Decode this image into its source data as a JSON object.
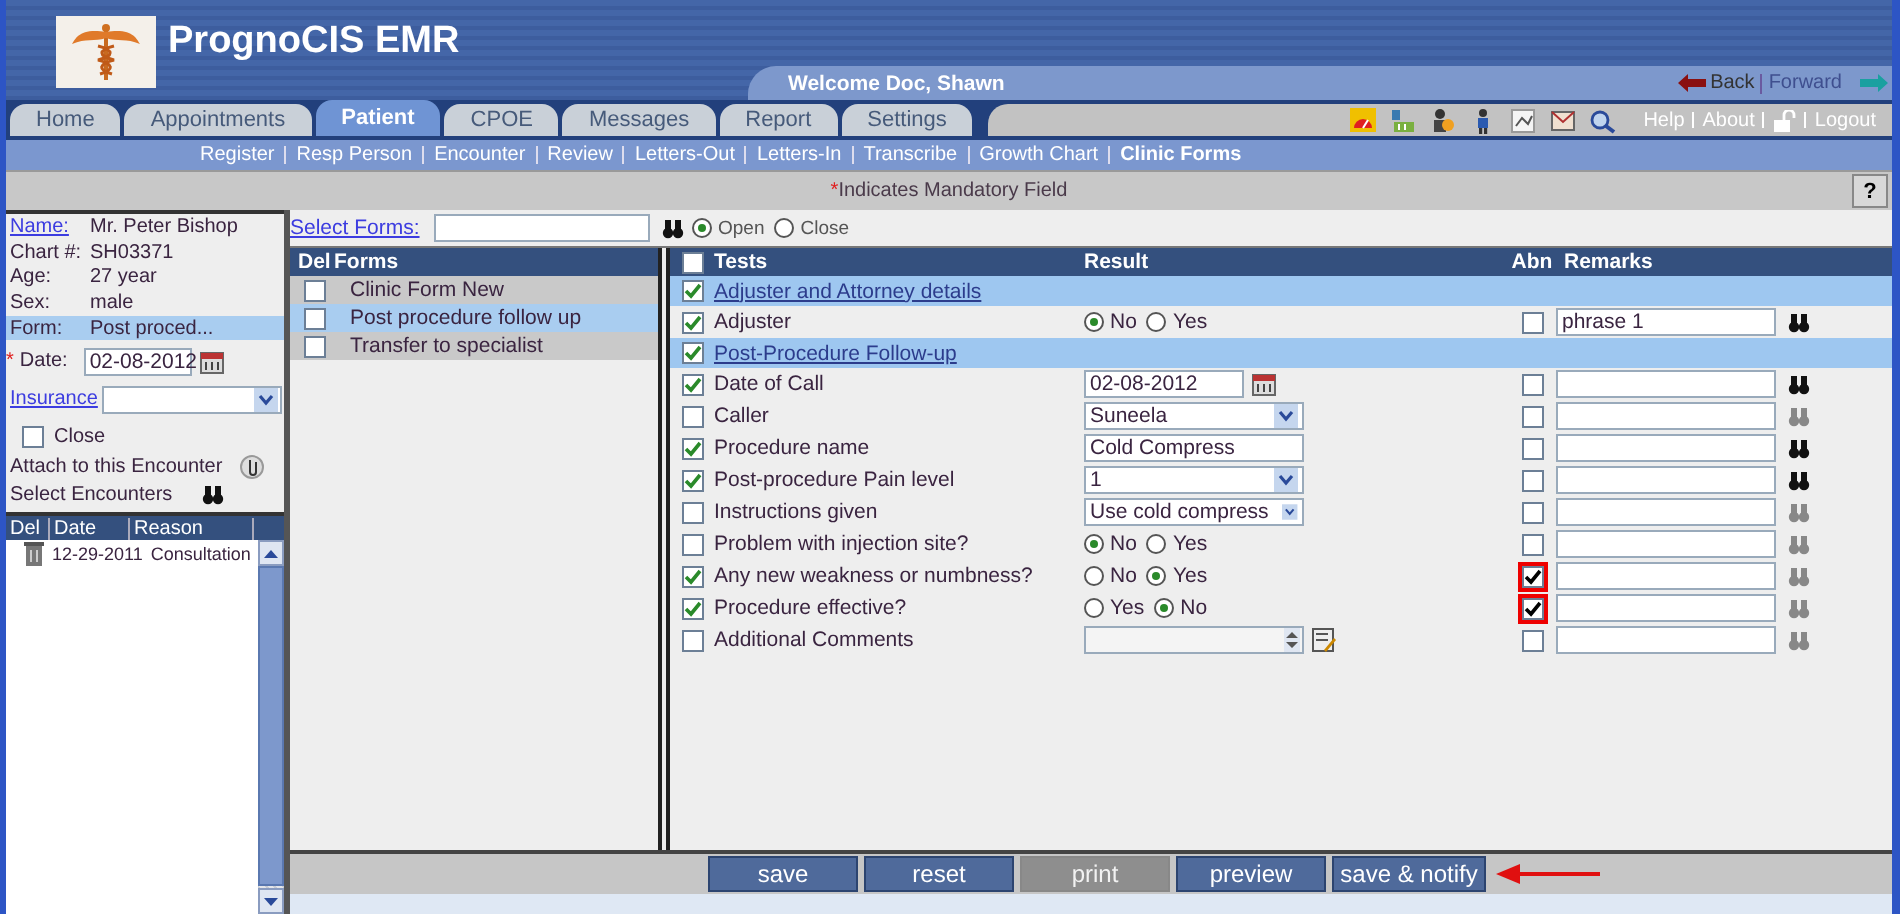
{
  "app": {
    "title": "PrognoCIS EMR",
    "welcome": "Welcome Doc, Shawn",
    "back": "Back",
    "forward": "Forward"
  },
  "tabs": [
    {
      "label": "Home",
      "selected": false
    },
    {
      "label": "Appointments",
      "selected": false
    },
    {
      "label": "Patient",
      "selected": true
    },
    {
      "label": "CPOE",
      "selected": false
    },
    {
      "label": "Messages",
      "selected": false
    },
    {
      "label": "Report",
      "selected": false
    },
    {
      "label": "Settings",
      "selected": false
    }
  ],
  "toolbar_links": [
    "Help",
    "About",
    "Logout"
  ],
  "subnav": [
    {
      "label": "Register",
      "selected": false
    },
    {
      "label": "Resp Person",
      "selected": false
    },
    {
      "label": "Encounter",
      "selected": false
    },
    {
      "label": "Review",
      "selected": false
    },
    {
      "label": "Letters-Out",
      "selected": false
    },
    {
      "label": "Letters-In",
      "selected": false
    },
    {
      "label": "Transcribe",
      "selected": false
    },
    {
      "label": "Growth Chart",
      "selected": false
    },
    {
      "label": "Clinic Forms",
      "selected": true
    }
  ],
  "mandatory_note": {
    "mark": "*",
    "text": "Indicates Mandatory Field"
  },
  "help_button": "?",
  "patient": {
    "fields": [
      {
        "label": "Name:",
        "value": "Mr. Peter Bishop",
        "link": true,
        "highlighted": false
      },
      {
        "label": "Chart #:",
        "value": "SH03371",
        "link": false,
        "highlighted": false
      },
      {
        "label": "Age:",
        "value": "27 year",
        "link": false,
        "highlighted": false
      },
      {
        "label": "Sex:",
        "value": "male",
        "link": false,
        "highlighted": false
      },
      {
        "label": "Form:",
        "value": "Post proced...",
        "link": false,
        "highlighted": true
      }
    ],
    "date": {
      "mark": "*",
      "label": "Date:",
      "value": "02-08-2012"
    },
    "insurance": {
      "label": "Insurance"
    },
    "close": {
      "label": "Close",
      "checked": false
    },
    "attach_label": "Attach to this Encounter",
    "select_encounters_label": "Select Encounters",
    "encounters": {
      "columns": [
        "Del",
        "Date",
        "Reason"
      ],
      "rows": [
        {
          "date": "12-29-2011",
          "reason": "Consultation"
        }
      ]
    }
  },
  "forms": {
    "select_label": "Select Forms:",
    "mode": [
      {
        "label": "Open",
        "selected": true
      },
      {
        "label": "Close",
        "selected": false
      }
    ],
    "columns": [
      "Del",
      "Forms"
    ],
    "rows": [
      {
        "name": "Clinic Form New",
        "checked": false,
        "selected": false
      },
      {
        "name": "Post procedure follow up",
        "checked": false,
        "selected": true
      },
      {
        "name": "Transfer to specialist",
        "checked": false,
        "selected": false
      }
    ]
  },
  "tests": {
    "columns": [
      "Tests",
      "Result",
      "Abn",
      "Remarks"
    ],
    "header_checked": false,
    "rows": [
      {
        "kind": "section",
        "label": "Adjuster and Attorney details",
        "checked": true
      },
      {
        "kind": "radio",
        "label": "Adjuster",
        "checked": true,
        "options": [
          {
            "label": "No",
            "selected": true
          },
          {
            "label": "Yes",
            "selected": false
          }
        ],
        "abn": false,
        "flagged": false,
        "remark": "phrase 1",
        "lookup_active": true
      },
      {
        "kind": "section",
        "label": "Post-Procedure Follow-up",
        "checked": true
      },
      {
        "kind": "date",
        "label": "Date of Call",
        "checked": true,
        "value": "02-08-2012",
        "abn": false,
        "flagged": false,
        "lookup_active": true
      },
      {
        "kind": "select",
        "label": "Caller",
        "checked": false,
        "value": "Suneela",
        "abn": false,
        "flagged": false,
        "lookup_active": false
      },
      {
        "kind": "text",
        "label": "Procedure name",
        "checked": true,
        "value": "Cold Compress",
        "abn": false,
        "flagged": false,
        "lookup_active": true
      },
      {
        "kind": "select",
        "label": "Post-procedure Pain level",
        "checked": true,
        "value": "1",
        "abn": false,
        "flagged": false,
        "lookup_active": true
      },
      {
        "kind": "select",
        "label": "Instructions given",
        "checked": false,
        "value": "Use cold compress",
        "abn": false,
        "flagged": false,
        "lookup_active": false
      },
      {
        "kind": "radio",
        "label": "Problem with injection site?",
        "checked": false,
        "options": [
          {
            "label": "No",
            "selected": true
          },
          {
            "label": "Yes",
            "selected": false
          }
        ],
        "abn": false,
        "flagged": false,
        "lookup_active": false
      },
      {
        "kind": "radio",
        "label": "Any new weakness or numbness?",
        "checked": true,
        "options": [
          {
            "label": "No",
            "selected": false
          },
          {
            "label": "Yes",
            "selected": true
          }
        ],
        "abn": true,
        "flagged": true,
        "lookup_active": false
      },
      {
        "kind": "radio",
        "label": "Procedure effective?",
        "checked": true,
        "options": [
          {
            "label": "Yes",
            "selected": false
          },
          {
            "label": "No",
            "selected": true
          }
        ],
        "abn": true,
        "flagged": true,
        "lookup_active": false
      },
      {
        "kind": "textarea",
        "label": "Additional Comments",
        "checked": false,
        "abn": false,
        "flagged": false,
        "lookup_active": false
      }
    ]
  },
  "buttons": [
    {
      "label": "save",
      "disabled": false
    },
    {
      "label": "reset",
      "disabled": false
    },
    {
      "label": "print",
      "disabled": true
    },
    {
      "label": "preview",
      "disabled": false
    },
    {
      "label": "save & notify",
      "disabled": false
    }
  ]
}
